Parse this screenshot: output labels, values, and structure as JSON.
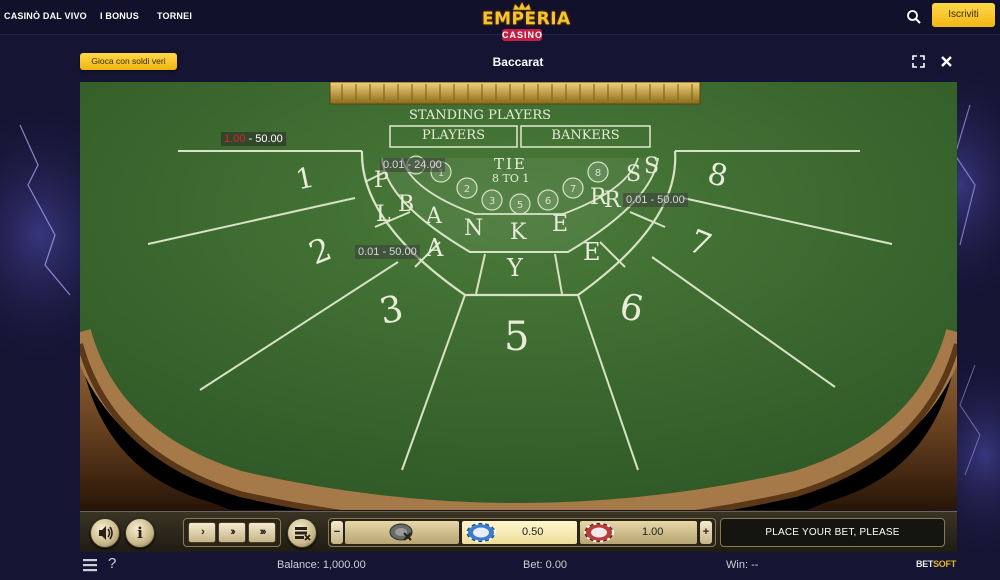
{
  "nav": {
    "items": [
      "CASINÒ DAL VIVO",
      "I BONUS",
      "TORNEI"
    ],
    "logo_top": "EMPERIA",
    "logo_bottom": "CASINO",
    "signup_label": "Iscriviti"
  },
  "game_header": {
    "real_money_label": "Gioca con soldi veri",
    "title": "Baccarat"
  },
  "table": {
    "standing_players": "STANDING PLAYERS",
    "players_btn": "PLAYERS",
    "bankers_btn": "BANKERS",
    "tie": "TIE",
    "tie_payout": "8 TO 1",
    "banker_letters": [
      "B",
      "A",
      "N",
      "K",
      "E",
      "R",
      "S"
    ],
    "player_letters": [
      "P",
      "L",
      "A",
      "Y",
      "E",
      "R",
      "S"
    ],
    "seat_numbers": [
      "1",
      "2",
      "3",
      "5",
      "6",
      "7",
      "8"
    ],
    "limits": {
      "table_min": "1.00",
      "table_max": "50.00",
      "tie": "0.01 - 24.00",
      "banker": "0.01 - 50.00",
      "player": "0.01 - 50.00"
    }
  },
  "controls": {
    "chip_values": [
      "0.50",
      "1.00"
    ],
    "status": "PLACE YOUR BET, PLEASE"
  },
  "footer": {
    "balance_label": "Balance:",
    "balance": "1,000.00",
    "bet_label": "Bet:",
    "bet": "0.00",
    "win_label": "Win:",
    "win": "--",
    "brand_a": "BET",
    "brand_b": "SOFT"
  },
  "colors": {
    "felt": "#3d6a31",
    "accent_yellow": "#f7c82b",
    "page_bg": "#151433"
  }
}
